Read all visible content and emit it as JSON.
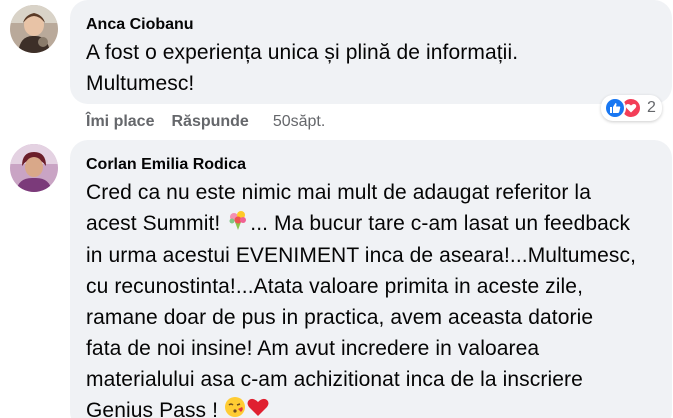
{
  "comments": [
    {
      "author": "Anca Ciobanu",
      "text_lines": [
        "A fost o experiența unica și plină de informații.",
        "Multumesc!"
      ],
      "actions": {
        "like": "Îmi place",
        "reply": "Răspunde",
        "time": "50săpt."
      },
      "reactions": {
        "icons": [
          "like-icon",
          "love-icon"
        ],
        "count": "2"
      }
    },
    {
      "author": "Corlan Emilia Rodica",
      "text_lines": [
        "Cred ca nu este nimic mai mult de adaugat referitor la",
        "... Ma bucur tare c-am lasat un feedback",
        "in urma acestui EVENIMENT inca de aseara!...Multumesc,",
        "cu recunostinta!...Atata valoare primita in aceste zile,",
        "ramane doar de pus in practica, avem aceasta datorie",
        "fata de noi insine! Am avut incredere in valoarea",
        "materialului asa c-am achizitionat inca de la inscriere",
        "Genius Pass !"
      ],
      "line2_prefix": "acest Summit!",
      "emojis": [
        "bouquet-emoji",
        "kissing-face-emoji",
        "red-heart-emoji"
      ]
    }
  ],
  "colors": {
    "bubble": "#f0f2f5",
    "secondary_text": "#65676b",
    "like_blue": "#1877f2",
    "love_red": "#f33e58"
  }
}
